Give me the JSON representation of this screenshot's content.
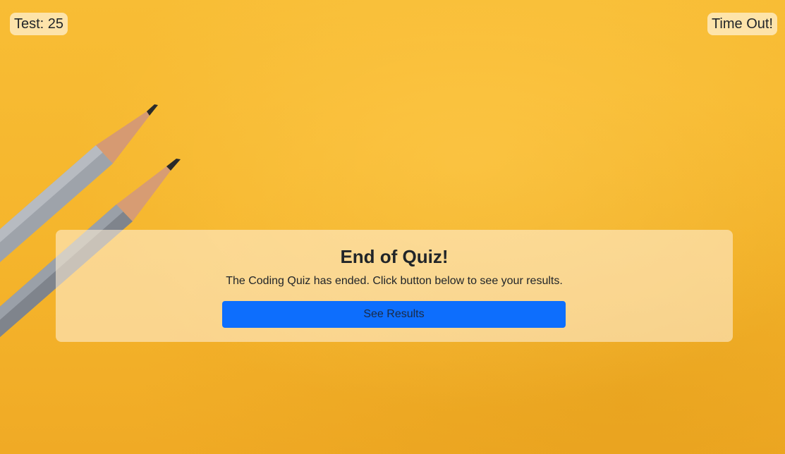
{
  "header": {
    "score_label": "Test: 25",
    "timer_label": "Time Out!"
  },
  "end_card": {
    "title": "End of Quiz!",
    "message": "The Coding Quiz has ended. Click button below to see your results.",
    "button_label": "See Results"
  },
  "colors": {
    "background": "#f5b62c",
    "button": "#0d6efd"
  }
}
